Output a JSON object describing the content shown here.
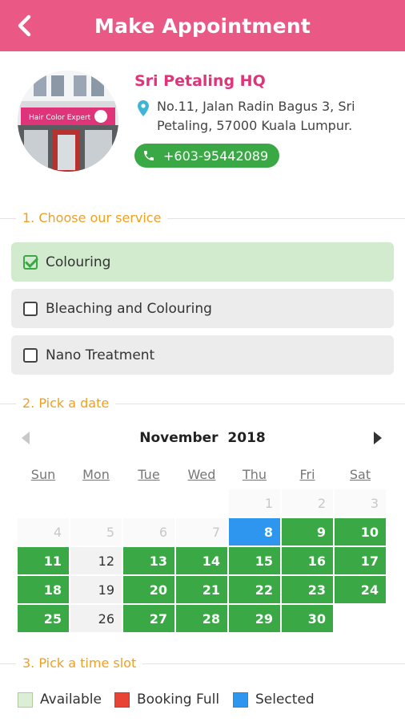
{
  "header": {
    "title": "Make Appointment",
    "back_icon": "chevron-left-icon"
  },
  "salon": {
    "name": "Sri Petaling HQ",
    "address": "No.11, Jalan Radin Bagus 3, Sri Petaling, 57000 Kuala Lumpur.",
    "phone": "+603-95442089",
    "photo_sign": "Hair Color Expert"
  },
  "colors": {
    "brand": "#ea5986",
    "accent_text": "#e0347a",
    "section_label": "#f0a020",
    "available": "#3aa845",
    "selected": "#2f96f0",
    "booking_full": "#e84435"
  },
  "sections": {
    "service": "1. Choose our service",
    "date": "2. Pick a date",
    "time": "3. Pick a time slot"
  },
  "services": [
    {
      "label": "Colouring",
      "checked": true
    },
    {
      "label": "Bleaching and Colouring",
      "checked": false
    },
    {
      "label": "Nano Treatment",
      "checked": false
    }
  ],
  "calendar": {
    "month": "November",
    "year": "2018",
    "weekdays": [
      "Sun",
      "Mon",
      "Tue",
      "Wed",
      "Thu",
      "Fri",
      "Sat"
    ],
    "weeks": [
      [
        {
          "d": "",
          "s": "blank"
        },
        {
          "d": "",
          "s": "blank"
        },
        {
          "d": "",
          "s": "blank"
        },
        {
          "d": "",
          "s": "blank"
        },
        {
          "d": "1",
          "s": "empty"
        },
        {
          "d": "2",
          "s": "empty"
        },
        {
          "d": "3",
          "s": "empty"
        }
      ],
      [
        {
          "d": "4",
          "s": "empty"
        },
        {
          "d": "5",
          "s": "empty"
        },
        {
          "d": "6",
          "s": "empty"
        },
        {
          "d": "7",
          "s": "empty"
        },
        {
          "d": "8",
          "s": "sel"
        },
        {
          "d": "9",
          "s": "avail"
        },
        {
          "d": "10",
          "s": "avail"
        }
      ],
      [
        {
          "d": "11",
          "s": "avail"
        },
        {
          "d": "12",
          "s": "closed"
        },
        {
          "d": "13",
          "s": "avail"
        },
        {
          "d": "14",
          "s": "avail"
        },
        {
          "d": "15",
          "s": "avail"
        },
        {
          "d": "16",
          "s": "avail"
        },
        {
          "d": "17",
          "s": "avail"
        }
      ],
      [
        {
          "d": "18",
          "s": "avail"
        },
        {
          "d": "19",
          "s": "closed"
        },
        {
          "d": "20",
          "s": "avail"
        },
        {
          "d": "21",
          "s": "avail"
        },
        {
          "d": "22",
          "s": "avail"
        },
        {
          "d": "23",
          "s": "avail"
        },
        {
          "d": "24",
          "s": "avail"
        }
      ],
      [
        {
          "d": "25",
          "s": "avail"
        },
        {
          "d": "26",
          "s": "closed"
        },
        {
          "d": "27",
          "s": "avail"
        },
        {
          "d": "28",
          "s": "avail"
        },
        {
          "d": "29",
          "s": "avail"
        },
        {
          "d": "30",
          "s": "avail"
        },
        {
          "d": "",
          "s": "blank"
        }
      ]
    ]
  },
  "legend": [
    {
      "label": "Available",
      "color": "#dcefd4",
      "border": "#a9cc9e"
    },
    {
      "label": "Booking Full",
      "color": "#e84435",
      "border": "#d23525"
    },
    {
      "label": "Selected",
      "color": "#2f96f0",
      "border": "#2a86d8"
    }
  ]
}
